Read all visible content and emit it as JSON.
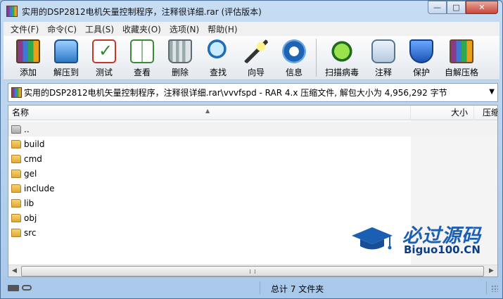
{
  "window": {
    "title": "实用的DSP2812电机矢量控制程序，注释很详细.rar (评估版本)",
    "min_glyph": "—",
    "max_glyph": "□",
    "close_glyph": "✕"
  },
  "menu": [
    "文件(F)",
    "命令(C)",
    "工具(S)",
    "收藏夹(O)",
    "选项(N)",
    "帮助(H)"
  ],
  "toolbar": {
    "add": "添加",
    "extract": "解压到",
    "test": "测试",
    "view": "查看",
    "delete": "删除",
    "find": "查找",
    "wizard": "向导",
    "info": "信息",
    "virus": "扫描病毒",
    "comment": "注释",
    "protect": "保护",
    "sfx": "自解压格"
  },
  "address": {
    "text": "实用的DSP2812电机矢量控制程序，注释很详细.rar\\vvvfspd - RAR 4.x 压缩文件, 解包大小为 4,956,292 字节",
    "dropdown_glyph": "▼"
  },
  "columns": {
    "name": "名称",
    "size": "大小",
    "packed": "压缩",
    "sort_glyph": "▲"
  },
  "files": [
    "..",
    "build",
    "cmd",
    "gel",
    "include",
    "lib",
    "obj",
    "src"
  ],
  "scroll": {
    "left_glyph": "◀",
    "right_glyph": "▶"
  },
  "watermark": {
    "title": "必过源码",
    "subtitle": "Biguo100.CN"
  },
  "status": {
    "summary": "总计 7 文件夹"
  }
}
